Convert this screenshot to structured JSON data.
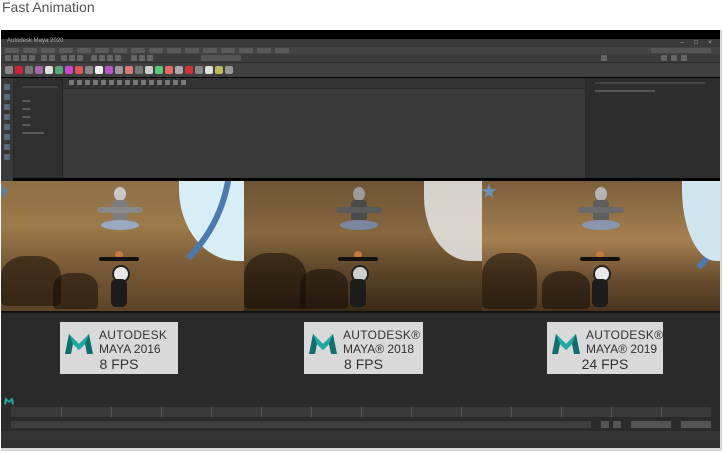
{
  "caption": "Fast Animation",
  "app": {
    "title": "Autodesk Maya 2020"
  },
  "colors": {
    "badge_bg": "#d9d9d9",
    "maya_teal": "#1fa9a4",
    "maya_teal_dark": "#0f6f6c",
    "ui_dark": "#2b2b2b"
  },
  "comparisons": [
    {
      "brand": "AUTODESK",
      "product": "MAYA 2016",
      "fps": "8 FPS",
      "logo_icon": "maya-logo-icon"
    },
    {
      "brand": "AUTODESK®",
      "product": "MAYA® 2018",
      "fps": "8 FPS",
      "logo_icon": "maya-logo-icon"
    },
    {
      "brand": "AUTODESK®",
      "product": "MAYA® 2019",
      "fps": "24 FPS",
      "logo_icon": "maya-logo-icon"
    }
  ],
  "window_controls": [
    "–",
    "□",
    "×"
  ]
}
